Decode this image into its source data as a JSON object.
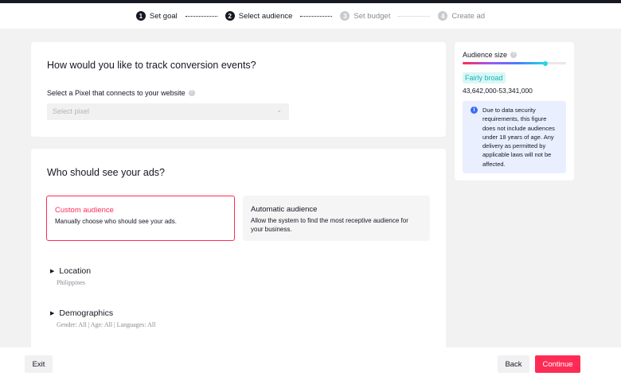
{
  "stepper": {
    "steps": [
      {
        "num": "1",
        "label": "Set goal"
      },
      {
        "num": "2",
        "label": "Select audience"
      },
      {
        "num": "3",
        "label": "Set budget"
      },
      {
        "num": "4",
        "label": "Create ad"
      }
    ]
  },
  "tracking": {
    "title": "How would you like to track conversion events?",
    "pixel_label": "Select a Pixel that connects to your website",
    "pixel_placeholder": "Select pixel"
  },
  "audience": {
    "title": "Who should see your ads?",
    "options": [
      {
        "title": "Custom audience",
        "desc": "Manually choose who should see your ads.",
        "selected": true
      },
      {
        "title": "Automatic audience",
        "desc": "Allow the system to find the most receptive audience for your business.",
        "selected": false
      }
    ],
    "sections": [
      {
        "title": "Location",
        "summary": "Philippines"
      },
      {
        "title": "Demographics",
        "summary": "Gender: All | Age: All | Languages: All"
      }
    ]
  },
  "sidebar": {
    "title": "Audience size",
    "level_fraction": 0.8,
    "level_label": "Fairly broad",
    "range": "43,642,000-53,341,000",
    "note": "Due to data security requirements, this figure does not include audiences under 18 years of age. Any delivery as permitted by applicable laws will not be affected."
  },
  "footer": {
    "exit": "Exit",
    "back": "Back",
    "continue": "Continue"
  },
  "colors": {
    "accent": "#fe2c55",
    "dark": "#161823",
    "info": "#3b6cf6"
  }
}
